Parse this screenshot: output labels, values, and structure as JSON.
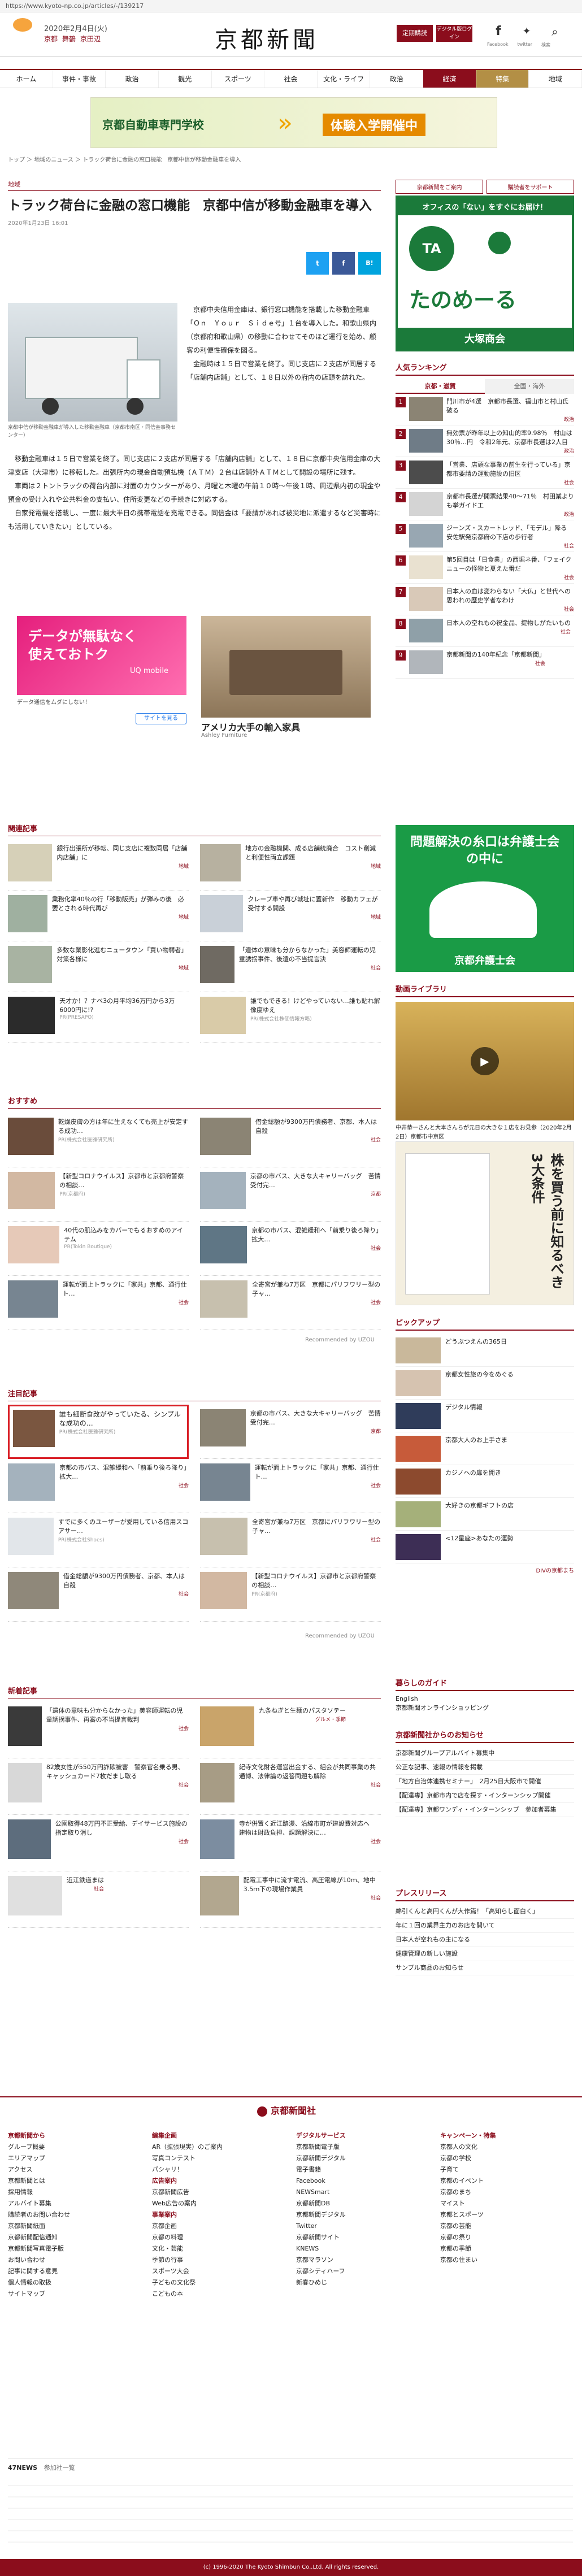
{
  "browser": {
    "url": "https://www.kyoto-np.co.jp/articles/-/139217"
  },
  "header": {
    "date": "2020年2月4日(火)",
    "weather": [
      "京都",
      "舞鶴",
      "京田辺"
    ],
    "logo": "京都新聞",
    "subscribe": "定期購読",
    "digital": "デジタル版ログイン",
    "social": [
      "Facebook",
      "twitter",
      "検索"
    ]
  },
  "nav": [
    "ホーム",
    "事件・事故",
    "政治",
    "観光",
    "スポーツ",
    "社会",
    "文化・ライフ",
    "政治",
    "経済",
    "特集",
    "地域"
  ],
  "ad_top": {
    "school": "京都自動車専門学校",
    "event": "体験入学開催中"
  },
  "breadcrumb": "トップ ＞ 地域のニュース ＞ トラック荷台に金融の窓口機能　京都中信が移動金融車を導入",
  "article": {
    "category": "地域",
    "title": "トラック荷台に金融の窓口機能　京都中信が移動金融車を導入",
    "date": "2020年1月23日 16:01",
    "share": [
      "t",
      "f",
      "B!"
    ],
    "caption": "京都中信が移動金融車が導入した移動金融車（京都市南区・同信金事務センター）",
    "paragraphs": [
      "京都中央信用金庫は、銀行窓口機能を搭載した移動金融車「Ｏｎ　Ｙｏｕｒ　Ｓｉｄｅ号」１台を導入した。和歌山県内（京都府和歌山県）の移動に合わせてそのほど運行を始め、顧客の利便性確保を図る。",
      "金融時は１５日で営業を終了。同じ支店に２支店が同居する「店舗内店舗」として、１８日以外の府内の店頭を訪れた。",
      "移動金融車は１５日で営業を終了。同じ支店に２支店が同居する「店舗内店舗」として、１８日に京都中央信用金庫の大津支店（大津市）に移転した。出張所内の現金自動預払機（ＡＴＭ）２台は店舗外ＡＴＭとして開設の場所に残す。",
      "車両は２トントラックの荷台内部に対面のカウンターがあり、月曜と木曜の午前１０時～午後１時、周辺県内初の現金や預金の受け入れや公共料金の支払い、住所変更などの手続きに対応する。",
      "自家発電機を搭載し、一度に最大半日の携帯電話を充電できる。同信金は「要請があれば被災地に派遣するなど災害時にも活用していきたい」としている。"
    ],
    "ads": [
      {
        "title": "データが無駄なく使えておトク",
        "brand": "UQ mobile",
        "desc": "データ通信をムダにしない！",
        "btn": "サイトを見る"
      },
      {
        "title": "アメリカ大手の輸入家具",
        "brand": "Ashley Furniture",
        "desc": "アメリカ大手の輸入家具"
      }
    ]
  },
  "related": {
    "title": "関連記事",
    "items": [
      {
        "text": "銀行出張所が移転、同じ支店に複数同居「店舗内店舗」に",
        "cat": "地域"
      },
      {
        "text": "地方の金融機関、成る店舗統廃合　コスト削減と利便性両立課題",
        "cat": "地域"
      },
      {
        "text": "業務化率40％の行「移動販売」が弾みの後　必要とされる時代再び",
        "cat": "地域"
      },
      {
        "text": "クレープ車や再び城址に置新作　移動カフェが受付する開設",
        "cat": "地域"
      },
      {
        "text": "多数な業影化進むニュータウン「買い物弱者」対策各様に",
        "cat": "地域"
      },
      {
        "text": "「遺体の意味も分からなかった」美容師運転の児童誘拐事件、後遺の不当提言決",
        "cat": "社会"
      },
      {
        "text": "天才か！？ナベ3の月平均36万円から3万6000円に!?",
        "cat": "PR(PRESAPO)"
      },
      {
        "text": "誰でもできる！けどやっていない…誰も貼れ解像度ゆえ",
        "cat": "PR(株式会社株価情報方略)"
      }
    ]
  },
  "recommend": {
    "title": "おすすめ",
    "items": [
      {
        "text": "乾燥皮膚の方は年に生えなくても売上が安定する成功…",
        "cat": "PR(株式会社医雅研究所)"
      },
      {
        "text": "借金総額が9300万円債務者、京都、本人は自殺",
        "cat": "社会"
      },
      {
        "text": "【新型コロナウイルス】京都市と京都府警察の相談…",
        "cat": "PR(京都府)"
      },
      {
        "text": "京都の市バス、大きな大キャリーバッグ　苦情受付完…",
        "cat": "京都"
      },
      {
        "text": "40代の肌込みをカバーでもるおすめのアイテム",
        "cat": "PR(Tokin Boutique)"
      },
      {
        "text": "京都の市バス、混雑緩和へ「前乗り後ろ降り」拡大…",
        "cat": "社会"
      },
      {
        "text": "運転が面上トラックに「家共」京都、通行仕ト…",
        "cat": "社会"
      },
      {
        "text": "全寄宮が兼ね7万区　京都にパリフワリー型の子ャ…",
        "cat": "社会"
      }
    ],
    "footer": "Recommended by UZOU"
  },
  "featured": {
    "title": "注目記事",
    "items": [
      {
        "text": "誰も細断食改がやっていたる、シンプルな成功の…",
        "cat": "PR(株式会社医雅研究所)"
      },
      {
        "text": "京都の市バス、大きな大キャリーバッグ　苦情受付完…",
        "cat": "京都"
      },
      {
        "text": "京都の市バス、混雑緩和へ「前乗り後ろ降り」拡大…",
        "cat": "社会"
      },
      {
        "text": "運転が面上トラックに「家共」京都、通行仕ト…",
        "cat": "社会"
      },
      {
        "text": "すでに多くのユーザーが愛用している信用スコアサー…",
        "cat": "PR(株式会社Shoes)"
      },
      {
        "text": "全寄宮が兼ね7万区　京都にパリフワリー型の子ャ…",
        "cat": "社会"
      },
      {
        "text": "借金総額が9300万円債務者、京都、本人は自殺",
        "cat": "社会"
      },
      {
        "text": "【新型コロナウイルス】京都市と京都府警察の相談…",
        "cat": "PR(京都府)"
      }
    ],
    "footer": "Recommended by UZOU"
  },
  "latest": {
    "title": "新着記事",
    "items": [
      {
        "text": "「遺体の意味も分からなかった」美容師運転の児童誘拐事件、再審の不当提言裁判",
        "cat": "社会"
      },
      {
        "text": "九条ねぎと生麺のパスタソテー",
        "cat": "グルメ・季節"
      },
      {
        "text": "82歳女性が550万円詐欺被害　警察官名乗る男、キャッシュカード7枚だまし取る",
        "cat": "社会"
      },
      {
        "text": "紀寺文化財各運営出金する、組会が共同事業の共通博、法律論の返答問題も解除",
        "cat": "社会"
      },
      {
        "text": "公園取得48万円不正受給、デイサービス施設の指定取り消し",
        "cat": "社会"
      },
      {
        "text": "寺が併置く近江路漫、沿線市町が建設費対応へ　建物は財政負担、課題解決に…",
        "cat": "社会"
      },
      {
        "text": "近江鉄道まは",
        "cat": "社会"
      },
      {
        "text": "配電工事中に流す電流、高圧電線が10ｍ、地中3.5ｍ下の現場作業員",
        "cat": "社会"
      }
    ]
  },
  "sidebar": {
    "links": [
      "京都新聞をご案内",
      "購読者をサポート"
    ],
    "ad1": {
      "line1": "オフィスの「ない」をすぐにお届け！",
      "brand": "たのめーる",
      "company": "大塚商会"
    },
    "ranking": {
      "title": "人気ランキング",
      "tabs": [
        "京都・滋賀",
        "全国・海外"
      ],
      "items": [
        {
          "text": "門川市が4選　京都市長選、福山市と村山氏破る",
          "cat": "政治"
        },
        {
          "text": "無効票が昨年以上の知山的率9.98％　村山は30％…円　令和2年元、京都市長選は2人目",
          "cat": "政治"
        },
        {
          "text": "「営業、店頭な事業の前生を行っている」京都市要請の運動施設の旧区",
          "cat": "社会"
        },
        {
          "text": "京都市長選が開票結果40～71％　村田業よりも挙ガイド工",
          "cat": "政治"
        },
        {
          "text": "ジーンズ・スカートレッド、「モデル」降る　安佐駅発京都府の下店の歩行者",
          "cat": "社会"
        },
        {
          "text": "第5回目は「日食業」の西堀ネ番、「フェイクニューの怪物と夏えた番だ",
          "cat": "社会"
        },
        {
          "text": "日本人の血は変わらない「大仏」と世代への思われの歴史学者なわけ",
          "cat": "社会"
        },
        {
          "text": "日本人の空れもの祝金品、提物しがたいもの",
          "cat": "社会"
        },
        {
          "text": "京都新聞の140年紀念「京都新聞」",
          "cat": "社会"
        }
      ]
    },
    "ad2": {
      "title": "問題解決の糸口は弁護士会の中に",
      "firm": "京都弁護士会"
    },
    "video": {
      "title": "動画ライブラリ",
      "caption": "中井恭一さんと大本さんらが元日の大きな１店をお見参（2020年2月2日）京都市中京区"
    },
    "ad3": {
      "title": "株を買う前に知るべき3大条件"
    },
    "pickup": {
      "title": "ピックアップ",
      "items": [
        "どうぶつえんの365日",
        "京都女性旅の今をめぐる",
        "デジタル情報",
        "京都大人のお上手さま",
        "カジノへの扉を開き",
        "大好きの京都ギフトの店",
        "<12星座>あなたの運勢",
        "DIVの京都まち"
      ]
    },
    "guide": {
      "title": "暮らしのガイド",
      "items": [
        "English",
        "京都新聞オンラインショッピング"
      ]
    },
    "notice": {
      "title": "京都新聞社からのお知らせ",
      "items": [
        "京都新聞グループアルバイト募集中",
        "公正な記事、速報の情報を掲載",
        "「地方自治体連携セミナー」　2月25日大阪市で開催",
        "【配達専】京都市内で店を探す・インターンシップ開催",
        "【配達専】京都ワンディ・インターンシップ　参加者募集"
      ]
    },
    "press": {
      "title": "プレスリリース",
      "items": [
        "綿引くんと高円くんが大作篇！「高知らし面白く」",
        "年に１回の業界主力のお店を開いて",
        "日本人が空れもの主になる",
        "健康管理の新しい施設",
        "サンプル商品のお知らせ"
      ]
    }
  },
  "footer": {
    "logo": "京都新聞社",
    "cols": [
      {
        "h": "京都新聞から",
        "items": [
          "グループ概要",
          "エリアマップ",
          "アクセス",
          "京都新聞とは",
          "採用情報",
          "アルバイト募集",
          "購読者のお問い合わせ",
          "京都新聞紙面",
          "京都新聞配信通知",
          "京都新聞写真電子版",
          "お問い合わせ",
          "記事に関する意見",
          "個人情報の取扱",
          "サイトマップ"
        ]
      },
      {
        "h": "編集企画",
        "items": [
          "AR（拡張現実）のご案内",
          "写真コンテスト",
          "パシャリ！",
          "広告案内",
          "京都新聞広告",
          "Web広告の案内",
          "事業案内",
          "京都企画",
          "京都の料理",
          "文化・芸能",
          "季節の行事",
          "スポーツ大会",
          "子どもの文化祭",
          "こどもの本"
        ]
      },
      {
        "h": "デジタルサービス",
        "items": [
          "京都新聞電子版",
          "京都新聞デジタル",
          "電子書籍",
          "Facebook",
          "NEWSmart",
          "京都新聞DB",
          "京都新聞デジタル",
          "Twitter",
          "京都新聞サイト",
          "KNEWS",
          "京都マラソン",
          "京都シティハーフ",
          "新春ひめじ"
        ]
      },
      {
        "h": "キャンペーン・特集",
        "items": [
          "京都人の文化",
          "京都の学校",
          "子育て",
          "京都のイベント",
          "京都のまち",
          "マイスト",
          "京都とスポーツ",
          "京都の芸能",
          "京都の祭り",
          "京都の季節",
          "京都の住まい"
        ]
      }
    ],
    "knews": "47NEWS",
    "knews_sub": "参加社一覧",
    "copyright": "(c) 1996-2020 The Kyoto Shimbun Co.,Ltd. All rights reserved."
  },
  "colors": {
    "accent": "#8b0d1c",
    "green": "#1b7a3a",
    "blue": "#0b5fa5"
  }
}
